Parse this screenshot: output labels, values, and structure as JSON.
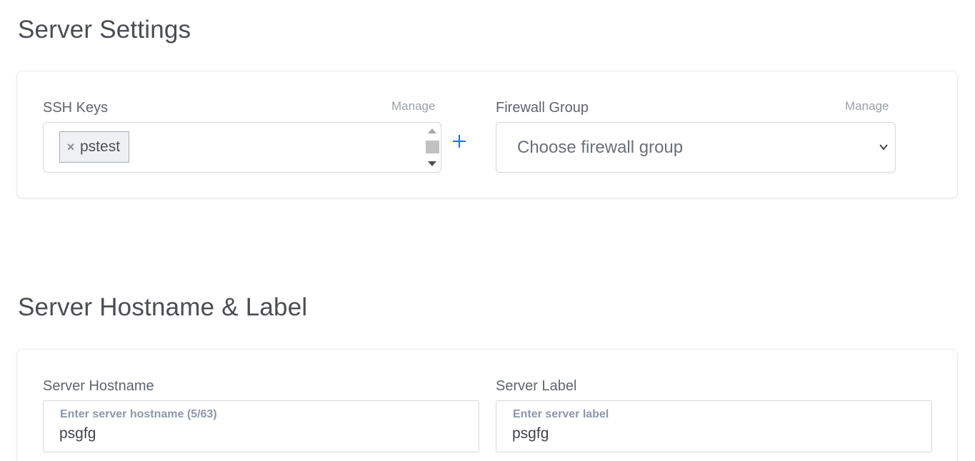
{
  "server_settings": {
    "title": "Server Settings",
    "ssh_keys": {
      "label": "SSH Keys",
      "manage_label": "Manage",
      "tags": [
        {
          "remove_symbol": "×",
          "label": "pstest"
        }
      ],
      "add_icon": "plus-icon"
    },
    "firewall_group": {
      "label": "Firewall Group",
      "manage_label": "Manage",
      "selected_value": "Choose firewall group"
    }
  },
  "hostname_label": {
    "title": "Server Hostname & Label",
    "hostname": {
      "label": "Server Hostname",
      "placeholder": "Enter server hostname (5/63)",
      "value": "psgfg"
    },
    "server_label": {
      "label": "Server Label",
      "placeholder": "Enter server label",
      "value": "psgfg"
    }
  },
  "colors": {
    "accent": "#1e6fd9",
    "text": "#4a4d55",
    "border": "#d3d7de"
  }
}
